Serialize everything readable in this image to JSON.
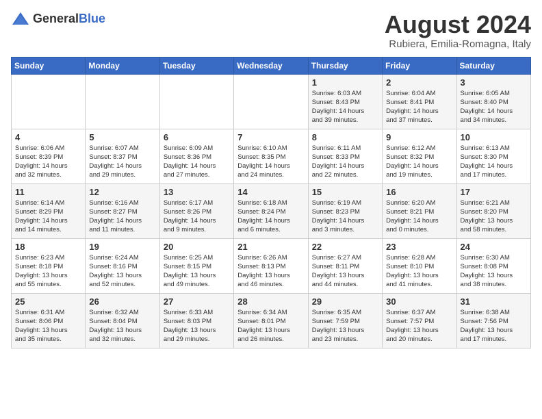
{
  "header": {
    "logo_general": "General",
    "logo_blue": "Blue",
    "title": "August 2024",
    "subtitle": "Rubiera, Emilia-Romagna, Italy"
  },
  "weekdays": [
    "Sunday",
    "Monday",
    "Tuesday",
    "Wednesday",
    "Thursday",
    "Friday",
    "Saturday"
  ],
  "weeks": [
    [
      {
        "day": "",
        "info": ""
      },
      {
        "day": "",
        "info": ""
      },
      {
        "day": "",
        "info": ""
      },
      {
        "day": "",
        "info": ""
      },
      {
        "day": "1",
        "info": "Sunrise: 6:03 AM\nSunset: 8:43 PM\nDaylight: 14 hours\nand 39 minutes."
      },
      {
        "day": "2",
        "info": "Sunrise: 6:04 AM\nSunset: 8:41 PM\nDaylight: 14 hours\nand 37 minutes."
      },
      {
        "day": "3",
        "info": "Sunrise: 6:05 AM\nSunset: 8:40 PM\nDaylight: 14 hours\nand 34 minutes."
      }
    ],
    [
      {
        "day": "4",
        "info": "Sunrise: 6:06 AM\nSunset: 8:39 PM\nDaylight: 14 hours\nand 32 minutes."
      },
      {
        "day": "5",
        "info": "Sunrise: 6:07 AM\nSunset: 8:37 PM\nDaylight: 14 hours\nand 29 minutes."
      },
      {
        "day": "6",
        "info": "Sunrise: 6:09 AM\nSunset: 8:36 PM\nDaylight: 14 hours\nand 27 minutes."
      },
      {
        "day": "7",
        "info": "Sunrise: 6:10 AM\nSunset: 8:35 PM\nDaylight: 14 hours\nand 24 minutes."
      },
      {
        "day": "8",
        "info": "Sunrise: 6:11 AM\nSunset: 8:33 PM\nDaylight: 14 hours\nand 22 minutes."
      },
      {
        "day": "9",
        "info": "Sunrise: 6:12 AM\nSunset: 8:32 PM\nDaylight: 14 hours\nand 19 minutes."
      },
      {
        "day": "10",
        "info": "Sunrise: 6:13 AM\nSunset: 8:30 PM\nDaylight: 14 hours\nand 17 minutes."
      }
    ],
    [
      {
        "day": "11",
        "info": "Sunrise: 6:14 AM\nSunset: 8:29 PM\nDaylight: 14 hours\nand 14 minutes."
      },
      {
        "day": "12",
        "info": "Sunrise: 6:16 AM\nSunset: 8:27 PM\nDaylight: 14 hours\nand 11 minutes."
      },
      {
        "day": "13",
        "info": "Sunrise: 6:17 AM\nSunset: 8:26 PM\nDaylight: 14 hours\nand 9 minutes."
      },
      {
        "day": "14",
        "info": "Sunrise: 6:18 AM\nSunset: 8:24 PM\nDaylight: 14 hours\nand 6 minutes."
      },
      {
        "day": "15",
        "info": "Sunrise: 6:19 AM\nSunset: 8:23 PM\nDaylight: 14 hours\nand 3 minutes."
      },
      {
        "day": "16",
        "info": "Sunrise: 6:20 AM\nSunset: 8:21 PM\nDaylight: 14 hours\nand 0 minutes."
      },
      {
        "day": "17",
        "info": "Sunrise: 6:21 AM\nSunset: 8:20 PM\nDaylight: 13 hours\nand 58 minutes."
      }
    ],
    [
      {
        "day": "18",
        "info": "Sunrise: 6:23 AM\nSunset: 8:18 PM\nDaylight: 13 hours\nand 55 minutes."
      },
      {
        "day": "19",
        "info": "Sunrise: 6:24 AM\nSunset: 8:16 PM\nDaylight: 13 hours\nand 52 minutes."
      },
      {
        "day": "20",
        "info": "Sunrise: 6:25 AM\nSunset: 8:15 PM\nDaylight: 13 hours\nand 49 minutes."
      },
      {
        "day": "21",
        "info": "Sunrise: 6:26 AM\nSunset: 8:13 PM\nDaylight: 13 hours\nand 46 minutes."
      },
      {
        "day": "22",
        "info": "Sunrise: 6:27 AM\nSunset: 8:11 PM\nDaylight: 13 hours\nand 44 minutes."
      },
      {
        "day": "23",
        "info": "Sunrise: 6:28 AM\nSunset: 8:10 PM\nDaylight: 13 hours\nand 41 minutes."
      },
      {
        "day": "24",
        "info": "Sunrise: 6:30 AM\nSunset: 8:08 PM\nDaylight: 13 hours\nand 38 minutes."
      }
    ],
    [
      {
        "day": "25",
        "info": "Sunrise: 6:31 AM\nSunset: 8:06 PM\nDaylight: 13 hours\nand 35 minutes."
      },
      {
        "day": "26",
        "info": "Sunrise: 6:32 AM\nSunset: 8:04 PM\nDaylight: 13 hours\nand 32 minutes."
      },
      {
        "day": "27",
        "info": "Sunrise: 6:33 AM\nSunset: 8:03 PM\nDaylight: 13 hours\nand 29 minutes."
      },
      {
        "day": "28",
        "info": "Sunrise: 6:34 AM\nSunset: 8:01 PM\nDaylight: 13 hours\nand 26 minutes."
      },
      {
        "day": "29",
        "info": "Sunrise: 6:35 AM\nSunset: 7:59 PM\nDaylight: 13 hours\nand 23 minutes."
      },
      {
        "day": "30",
        "info": "Sunrise: 6:37 AM\nSunset: 7:57 PM\nDaylight: 13 hours\nand 20 minutes."
      },
      {
        "day": "31",
        "info": "Sunrise: 6:38 AM\nSunset: 7:56 PM\nDaylight: 13 hours\nand 17 minutes."
      }
    ]
  ]
}
